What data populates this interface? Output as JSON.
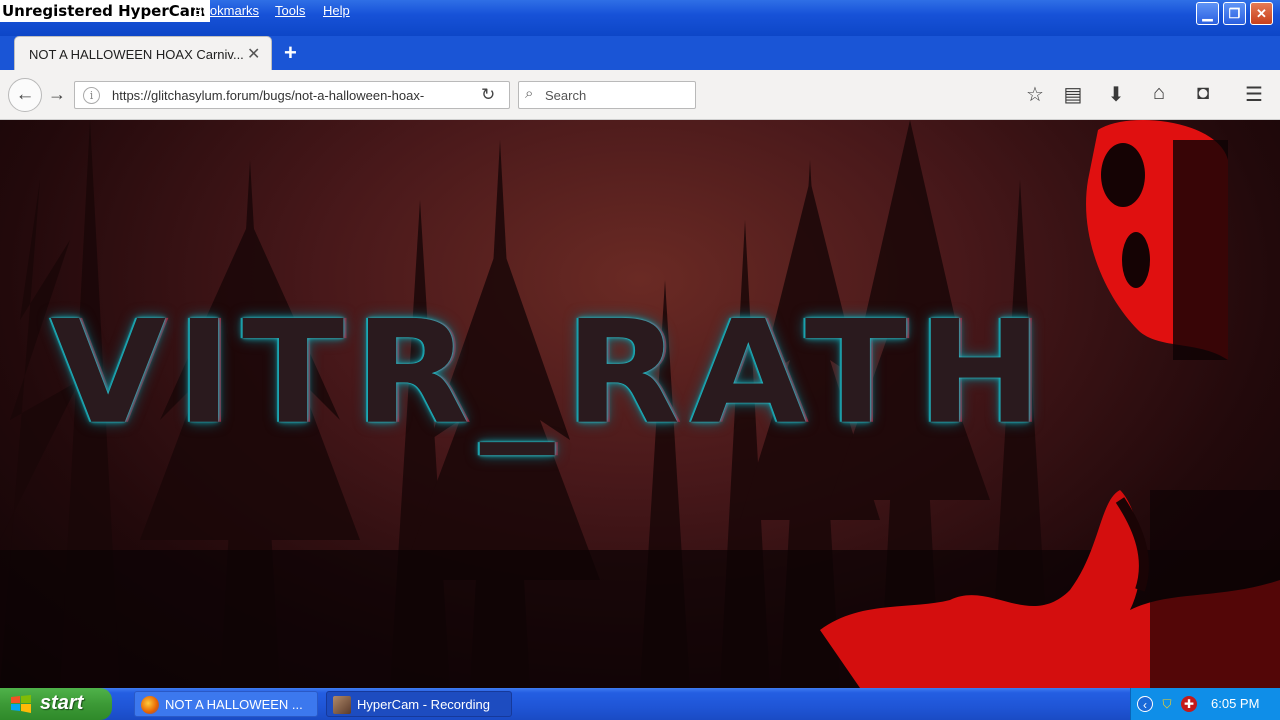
{
  "watermark": "Unregistered HyperCam",
  "menu": {
    "bookmarks": "Bookmarks",
    "tools": "Tools",
    "help": "Help"
  },
  "window_buttons": {
    "minimize": "▁",
    "maximize": "❐",
    "close": "✕"
  },
  "tab": {
    "title": "NOT A HALLOWEEN HOAX Carniv...",
    "close": "✕",
    "new_tab": "+"
  },
  "navbar": {
    "back": "←",
    "forward": "→",
    "info": "i",
    "url": "https://glitchasylum.forum/bugs/not-a-halloween-hoax-",
    "reload": "↻",
    "search_icon": "⌕",
    "search_placeholder": "Search",
    "icons": {
      "bookmark": "☆",
      "reading_list": "▤",
      "downloads": "⬇",
      "home": "⌂",
      "pocket": "◘",
      "menu": "☰"
    }
  },
  "content": {
    "title": "VITR_RATH"
  },
  "taskbar": {
    "start": "start",
    "tasks": [
      {
        "label": "NOT A HALLOWEEN ..."
      },
      {
        "label": "HyperCam - Recording"
      }
    ],
    "tray": {
      "clock": "6:05 PM",
      "chevron": "‹",
      "shield": "⛉",
      "security": "✚"
    }
  },
  "colors": {
    "taskbar_blue": "#1f55d6",
    "start_green": "#3c9a36",
    "glow_cyan": "#37d6e0",
    "glitch_red": "#c0102a",
    "ghost_red": "#e01010"
  }
}
